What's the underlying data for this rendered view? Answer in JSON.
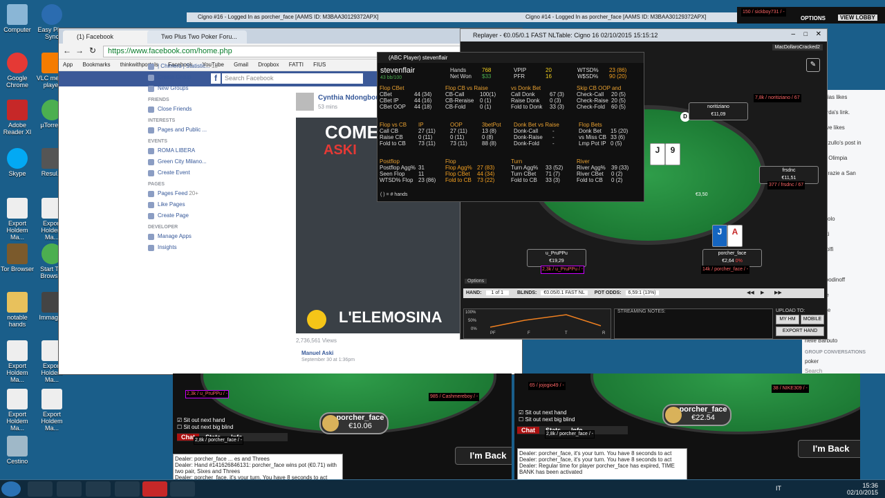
{
  "desktop": {
    "icons": [
      {
        "label": "Computer"
      },
      {
        "label": "Easy Ph... Sync"
      },
      {
        "label": "Google Chrome"
      },
      {
        "label": "VLC media player"
      },
      {
        "label": "Adobe Reader XI"
      },
      {
        "label": "µTorrent"
      },
      {
        "label": "Skype"
      },
      {
        "label": "Resul..."
      },
      {
        "label": "Export Holdem Ma..."
      },
      {
        "label": "Export Holdem Ma..."
      },
      {
        "label": "Tor Browser"
      },
      {
        "label": "Start Tor Browser"
      },
      {
        "label": "notable hands"
      },
      {
        "label": "Immagi..."
      },
      {
        "label": "Export Holdem Ma..."
      },
      {
        "label": "Export Holdem Ma..."
      },
      {
        "label": "Export Holdem Ma..."
      },
      {
        "label": "Export Holdem Ma..."
      },
      {
        "label": "Cestino"
      }
    ]
  },
  "top_windows": {
    "cigno16": "Cigno #16 - Logged In as porcher_face [AAMS ID: M3BAA30129372APX]",
    "cigno14": "Cigno #14 - Logged In as porcher_face [AAMS ID: M3BAA30129372APX]",
    "options": "OPTIONS",
    "view_lobby": "VIEW LOBBY"
  },
  "browser": {
    "tab1": "(1) Facebook",
    "tab2": "Two Plus Two Poker Foru...",
    "url": "https://www.facebook.com/home.php",
    "bookmarks": [
      "App",
      "Bookmarks",
      "thinkwithportals",
      "Facebook",
      "YouTube",
      "Gmail",
      "Dropbox",
      "FATTI",
      "FIUS"
    ],
    "search_placeholder": "Search Facebook",
    "sidebar": {
      "chimera": "| Chimera | Statistic...",
      "chimera_count": "18",
      "create_group": "Create Group",
      "new_groups": "New Groups",
      "friends_h": "FRIENDS",
      "close_friends": "Close Friends",
      "interests_h": "INTERESTS",
      "pages_public": "Pages and Public ...",
      "events_h": "EVENTS",
      "roma": "ROMA LIBERA",
      "green": "Green City Milano...",
      "create_event": "Create Event",
      "pages_h": "PAGES",
      "pages_feed": "Pages Feed",
      "pages_feed_count": "20+",
      "like_pages": "Like Pages",
      "create_page": "Create Page",
      "developer_h": "DEVELOPER",
      "manage_apps": "Manage Apps",
      "insights": "Insights"
    },
    "post": {
      "author": "Cynthia Ndongbou",
      "time": "53 mins",
      "video_text1": "COME",
      "video_text2": "ASKI",
      "video_text3": "L'ELEMOSINA",
      "views": "2,736,561 Views",
      "comment_author": "Manuel Aski",
      "comment_time": "September 30 at 1:36pm"
    }
  },
  "fb_right": {
    "items": [
      "hina Corrias likes",
      "nione Sarda's link.",
      "nica Soave likes",
      "anna Pezzullo's post in",
      "rcismo di Olimpia",
      "adonna grazie a San",
      "nnaro.",
      "Cini",
      "derico Triolo",
      "rgi Zanetti",
      "via Pandolfi",
      "Paga",
      "nitri Gospodinoff",
      "bbe Malle",
      "ra Capone",
      "a Liguori",
      "rielle Barbuto"
    ],
    "group_h": "GROUP CONVERSATIONS",
    "poker": "poker",
    "search": "Search"
  },
  "replayer": {
    "title": "Replayer - €0.05/0.1 FAST NLTable: Cigno 16   02/10/2015 15:15:12",
    "tab": "MacDollaroCracked2",
    "seats": {
      "noritiziano": {
        "name": "noritiziano",
        "stack": "€11,09"
      },
      "frsdnc": {
        "name": "frsdnc",
        "stack": "€11,51"
      },
      "u_pruppu": {
        "name": "u_PruPPu",
        "stack": "€19,29"
      },
      "porcher": {
        "name": "porcher_face",
        "stack": "€2,64",
        "pct": "0%"
      }
    },
    "pot": "€3,50",
    "board_cards": [
      "J",
      "9"
    ],
    "hero_cards": [
      "J",
      "A"
    ],
    "options": "Options",
    "hand_label": "HAND:",
    "hand_value": "1 of 1",
    "blinds_label": "BLINDS:",
    "blinds_value": "€0.05/0.1 FAST NL",
    "pot_odds_label": "POT ODDS:",
    "pot_odds_value": "6,59:1 (13%)",
    "graph_labels": [
      "100%",
      "50%",
      "0%"
    ],
    "graph_x": [
      "PF",
      "F",
      "T",
      "R"
    ],
    "notes_label": "STREAMING NOTES:",
    "upload_label": "UPLOAD TO:",
    "my_hm": "MY HM",
    "mobile": "MOBILE",
    "export": "EXPORT HAND"
  },
  "hud": {
    "title": "(ABC Player) stevenflair",
    "player": "stevenflair",
    "sub": "43 bb/100",
    "rows_head": [
      [
        "Hands",
        "768",
        "VPIP",
        "20",
        "WTSD%",
        "23 (86)"
      ],
      [
        "Net Won",
        "$33",
        "PFR",
        "16",
        "W$SD%",
        "90 (20)"
      ]
    ],
    "flop_cbet_h": [
      "Flop CBet",
      "Flop CB vs Raise",
      "vs Donk Bet",
      "Skip CB OOP and"
    ],
    "flop_cbet": [
      [
        "CBet",
        "44 (34)",
        "CB-Call",
        "100(1)",
        "Call Donk",
        "67 (3)",
        "Check-Call",
        "20 (5)"
      ],
      [
        "CBet IP",
        "44 (16)",
        "CB-Reraise",
        "0 (1)",
        "Raise Donk",
        "0 (3)",
        "Check-Raise",
        "20 (5)"
      ],
      [
        "CBet OOP",
        "44 (18)",
        "CB-Fold",
        "0 (1)",
        "Fold to Donk",
        "33 (3)",
        "Check-Fold",
        "60 (5)"
      ]
    ],
    "flop_vs_h": [
      "Flop vs CB",
      "IP",
      "OOP",
      "3betPot",
      "Donk Bet vs Raise",
      "Flop Bets"
    ],
    "flop_vs": [
      [
        "Call CB",
        "27 (11)",
        "27 (11)",
        "13 (8)",
        "Donk-Call",
        "-",
        "Donk Bet",
        "15 (20)"
      ],
      [
        "Raise CB",
        "0 (11)",
        "0 (11)",
        "0 (8)",
        "Donk-Raise",
        "-",
        "vs Miss CB",
        "33 (6)"
      ],
      [
        "Fold to CB",
        "73 (11)",
        "73 (11)",
        "88 (8)",
        "Donk-Fold",
        "-",
        "Lmp Pot IP",
        "0 (5)"
      ]
    ],
    "post_h": [
      "Postflop",
      "Flop",
      "Turn",
      "River"
    ],
    "post": [
      [
        "Postflop Agg%",
        "31",
        "Flop Agg%",
        "27 (83)",
        "Turn Agg%",
        "33 (52)",
        "River Agg%",
        "39 (33)"
      ],
      [
        "Seen Flop",
        "11",
        "Flop CBet",
        "44 (34)",
        "Turn CBet",
        "71 (7)",
        "River CBet",
        "0 (2)"
      ],
      [
        "WTSD% Flop",
        "23 (86)",
        "Fold to CB",
        "73 (22)",
        "Fold to CB",
        "33 (3)",
        "Fold to CB",
        "0 (2)"
      ]
    ],
    "footer": "( ) = # hands"
  },
  "table_left": {
    "hero_name": "porcher_face",
    "hero_stack": "€10.06",
    "imback": "I'm Back",
    "sitout1": "Sit out next hand",
    "sitout2": "Sit out next big blind",
    "tabs": [
      "Chat",
      "Stats",
      "Info"
    ],
    "chat": [
      "Dealer: porcher_face ... es and Threes",
      "Dealer: Hand #1416268461​31: porcher_face wins pot (€0.71) with two pair, Sixes and Threes",
      "Dealer: porcher_face, it's your turn. You have 8 seconds to act"
    ],
    "hud_opp": "2,3k / u_PruPPu / -",
    "hud_hero": "2,8k / porcher_face / -",
    "hud_cash": "985 / Cashmereboy / -"
  },
  "table_right": {
    "hero_name": "porcher_face",
    "hero_stack": "€22.54",
    "imback": "I'm Back",
    "sitout1": "Sit out next hand",
    "sitout2": "Sit out next big blind",
    "tabs": [
      "Chat",
      "Stats",
      "Info"
    ],
    "chat": [
      "Dealer: porcher_face, it's your turn. You have 8 seconds to act",
      "Dealer: porcher_face, it's your turn. You have 8 seconds to act",
      "Dealer: Regular time for player porcher_face has expired, TIME BANK has been activated"
    ],
    "hud_jojo": "65 / jojogio49 / -",
    "hud_nike": "38 / NIKE309 / -",
    "hud_hero": "2,8k / porcher_face / -",
    "hud_sick": "150 / sickboy731 / -",
    "hud_norit": "7,8k / noritiziano / 67",
    "hud_frsd": "377 / frsdnc / 67",
    "hud_prup": "2,3k / u_PruPPu / -",
    "hud_porch": "14k / porcher_face / -"
  },
  "taskbar": {
    "lang": "IT",
    "time": "15:36",
    "date": "02/10/2015"
  }
}
